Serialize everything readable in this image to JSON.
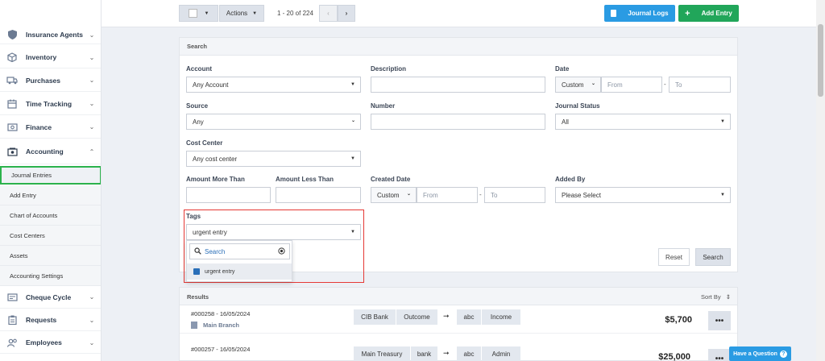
{
  "sidebar": {
    "items": [
      {
        "label": "Insurance Agents",
        "icon": "shield-icon"
      },
      {
        "label": "Inventory",
        "icon": "box-icon"
      },
      {
        "label": "Purchases",
        "icon": "truck-icon"
      },
      {
        "label": "Time Tracking",
        "icon": "calendar-icon"
      },
      {
        "label": "Finance",
        "icon": "money-icon"
      },
      {
        "label": "Accounting",
        "icon": "accounting-icon"
      },
      {
        "label": "Cheque Cycle",
        "icon": "cheque-icon"
      },
      {
        "label": "Requests",
        "icon": "clipboard-icon"
      },
      {
        "label": "Employees",
        "icon": "users-icon"
      }
    ],
    "sub_items": [
      "Journal Entries",
      "Add Entry",
      "Chart of Accounts",
      "Cost Centers",
      "Assets",
      "Accounting Settings"
    ]
  },
  "toolbar": {
    "actions_label": "Actions",
    "pagination": "1 - 20 of 224",
    "journal_logs_label": "Journal Logs",
    "add_entry_label": "Add Entry"
  },
  "search": {
    "title": "Search",
    "account_label": "Account",
    "account_value": "Any Account",
    "description_label": "Description",
    "date_label": "Date",
    "date_mode": "Custom",
    "from_placeholder": "From",
    "to_placeholder": "To",
    "source_label": "Source",
    "source_value": "Any",
    "number_label": "Number",
    "journal_status_label": "Journal Status",
    "journal_status_value": "All",
    "cost_center_label": "Cost Center",
    "cost_center_value": "Any cost center",
    "amount_more_label": "Amount More Than",
    "amount_less_label": "Amount Less Than",
    "created_date_label": "Created Date",
    "created_mode": "Custom",
    "added_by_label": "Added By",
    "added_by_value": "Please Select",
    "tags_label": "Tags",
    "tags_value": "urgent entry",
    "tags_search_placeholder": "Search",
    "tags_option": "urgent entry",
    "reset_label": "Reset",
    "search_label": "Search"
  },
  "results": {
    "title": "Results",
    "sort_label": "Sort By",
    "rows": [
      {
        "ref": "#000258 - 16/05/2024",
        "branch": "Main Branch",
        "chips_left": [
          "CIB Bank",
          "Outcome"
        ],
        "chips_right": [
          "abc",
          "Income"
        ],
        "amount": "$5,700"
      },
      {
        "ref": "#000257 - 16/05/2024",
        "branch": "",
        "chips_left": [
          "Main Treasury",
          "bank"
        ],
        "chips_right": [
          "abc",
          "Admin"
        ],
        "amount": "$25,000"
      }
    ]
  },
  "help_label": "Have a Question"
}
